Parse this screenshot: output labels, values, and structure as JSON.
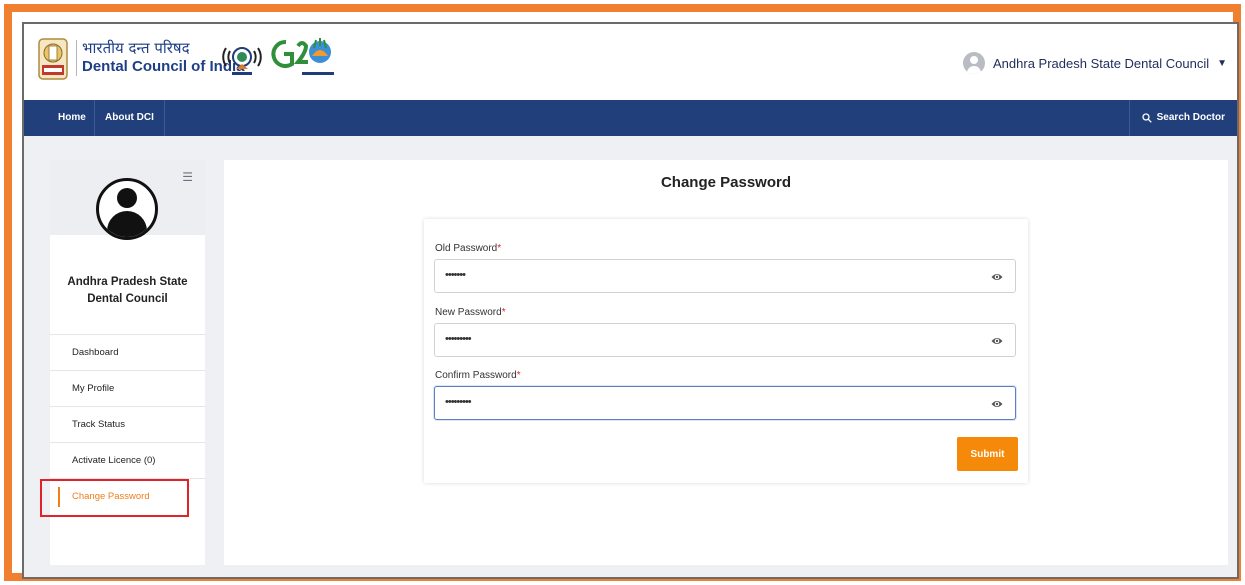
{
  "header": {
    "brand_hindi": "भारतीय दन्त परिषद",
    "brand_english": "Dental Council of India",
    "user_name": "Andhra Pradesh State Dental Council"
  },
  "nav": {
    "home": "Home",
    "about": "About DCI",
    "search": "Search Doctor"
  },
  "sidebar": {
    "org_name": "Andhra Pradesh State Dental Council",
    "items": [
      {
        "label": "Dashboard"
      },
      {
        "label": "My Profile"
      },
      {
        "label": "Track Status"
      },
      {
        "label": "Activate Licence (0)"
      },
      {
        "label": "Change Password"
      }
    ],
    "active_index": 4
  },
  "form": {
    "title": "Change Password",
    "old_password": {
      "label": "Old Password",
      "value": "•••••••"
    },
    "new_password": {
      "label": "New Password",
      "value": "•••••••••"
    },
    "confirm_password": {
      "label": "Confirm Password",
      "value": "•••••••••"
    },
    "required_mark": "*",
    "submit_label": "Submit"
  },
  "colors": {
    "frame": "#f07f30",
    "nav": "#213f7a",
    "accent": "#f58a0a",
    "highlight": "#e0222a"
  },
  "icons": [
    "user-avatar-icon",
    "chevron-down-icon",
    "search-icon",
    "collapse-menu-icon",
    "profile-avatar-icon",
    "eye-icon"
  ]
}
